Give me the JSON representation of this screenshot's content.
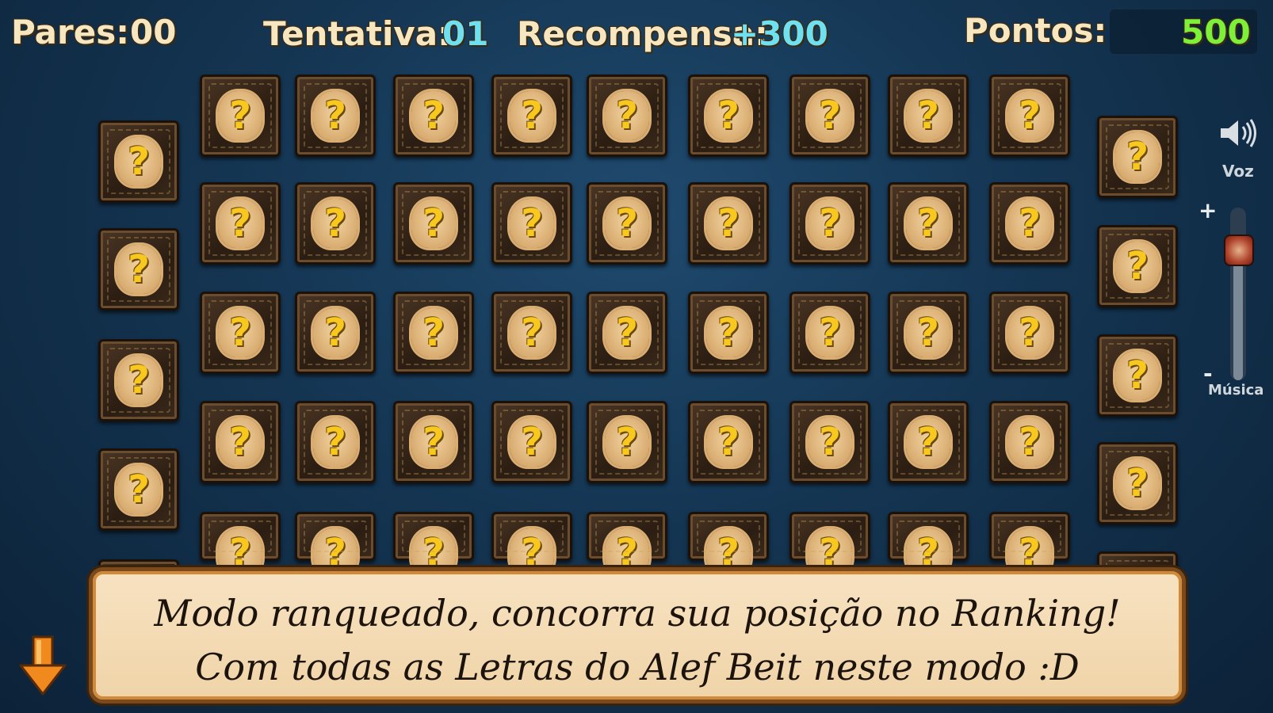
{
  "hud": {
    "pairs_label": "Pares:",
    "pairs_value": "00",
    "attempt_label": "Tentativa:",
    "attempt_value": "01",
    "reward_label": "Recompensa:",
    "reward_value": "+300",
    "points_label": "Pontos:",
    "points_value": "500"
  },
  "side_controls": {
    "voice_label": "Voz",
    "music_label": "Música",
    "plus": "+",
    "minus": "-",
    "music_volume": 0.8
  },
  "card": {
    "symbol": "?"
  },
  "message": {
    "line1": "Modo ranqueado, concorra sua posição no Ranking!",
    "line2": "Com todas as Letras do Alef Beit neste modo :D"
  },
  "colors": {
    "hud_text": "#f6e7c0",
    "hud_value": "#6fe0f0",
    "points_value": "#7ef03a",
    "card_symbol": "#f8c81e",
    "arrow": "#f08a1e"
  },
  "icons": {
    "voice": "speaker-icon",
    "scroll": "arrow-down-icon"
  }
}
